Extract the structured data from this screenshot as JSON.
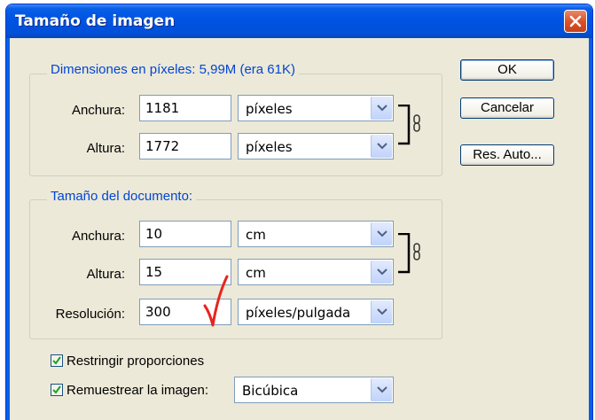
{
  "dialog": {
    "title": "Tamaño de imagen"
  },
  "pixel_dimensions": {
    "legend": "Dimensiones en píxeles: 5,99M (era 61K)",
    "width_label": "Anchura:",
    "width_value": "1181",
    "width_unit": "píxeles",
    "height_label": "Altura:",
    "height_value": "1772",
    "height_unit": "píxeles"
  },
  "document_size": {
    "legend": "Tamaño del documento:",
    "width_label": "Anchura:",
    "width_value": "10",
    "width_unit": "cm",
    "height_label": "Altura:",
    "height_value": "15",
    "height_unit": "cm",
    "resolution_label": "Resolución:",
    "resolution_value": "300",
    "resolution_unit": "píxeles/pulgada"
  },
  "options": {
    "constrain_label": "Restringir proporciones",
    "constrain_checked": true,
    "resample_label": "Remuestrear la imagen:",
    "resample_checked": true,
    "resample_method": "Bicúbica"
  },
  "buttons": {
    "ok": "OK",
    "cancel": "Cancelar",
    "auto": "Res. Auto..."
  },
  "icons": {
    "close": "close-icon",
    "link": "chain-link-icon",
    "dropdown": "chevron-down-icon",
    "check": "checkmark-icon",
    "annotation": "red-checkmark-icon"
  }
}
